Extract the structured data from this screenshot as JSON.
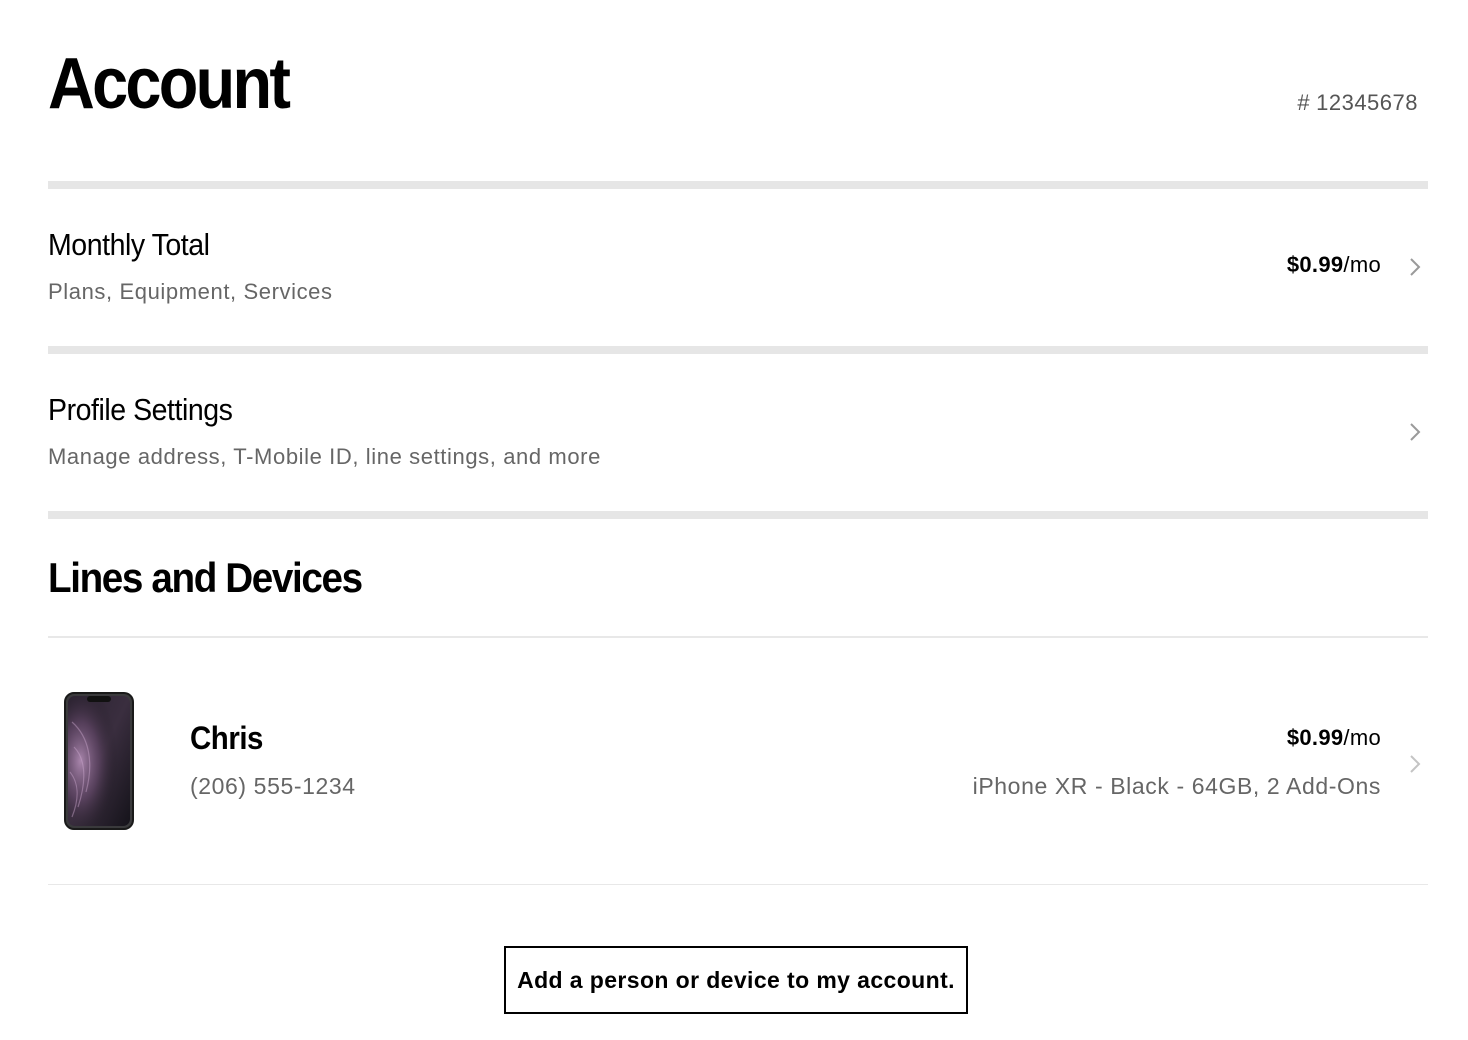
{
  "header": {
    "title": "Account",
    "account_number_prefix": "#",
    "account_number": "12345678"
  },
  "monthly_total": {
    "title": "Monthly Total",
    "subtitle": "Plans, Equipment, Services",
    "price_amount": "$0.99",
    "price_unit": "/mo",
    "chevron_icon": "chevron-right-icon"
  },
  "profile_settings": {
    "title": "Profile Settings",
    "subtitle": "Manage address, T-Mobile ID, line settings, and more",
    "chevron_icon": "chevron-right-icon"
  },
  "lines_and_devices": {
    "title": "Lines and Devices",
    "lines": [
      {
        "name": "Chris",
        "phone": "(206) 555-1234",
        "price_amount": "$0.99",
        "price_unit": "/mo",
        "device": "iPhone XR - Black - 64GB, 2 Add-Ons",
        "device_image": "iphone-xr-black-image"
      }
    ],
    "add_button_label": "Add a person or device to my account."
  },
  "colors": {
    "divider_thick": "#e6e6e6",
    "divider_thin": "#e8e8e8",
    "secondary_text": "#666666",
    "chevron": "#9a9a9a"
  }
}
